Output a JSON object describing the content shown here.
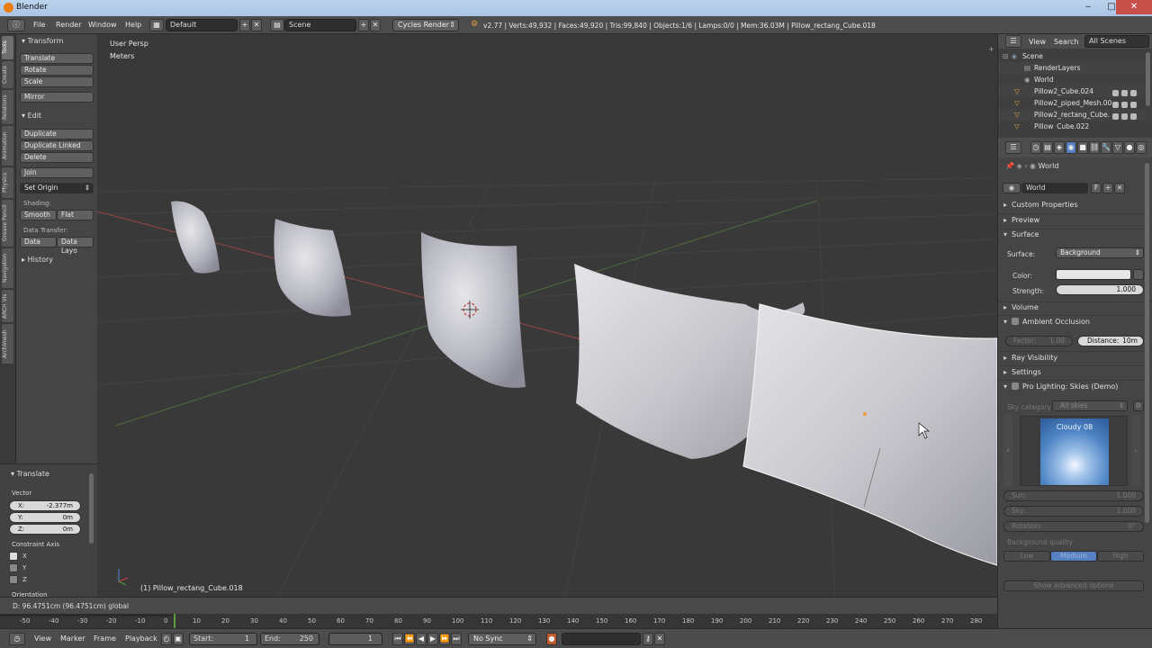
{
  "window": {
    "title": "Blender"
  },
  "menu": {
    "items": [
      "File",
      "Render",
      "Window",
      "Help"
    ]
  },
  "header": {
    "layout": "Default",
    "scene": "Scene",
    "engine": "Cycles Render",
    "stats": "v2.77 | Verts:49,932 | Faces:49,920 | Tris:99,840 | Objects:1/6 | Lamps:0/0 | Mem:36.03M | Pillow_rectang_Cube.018"
  },
  "tool_tabs": [
    "Tools",
    "Create",
    "Relations",
    "Animation",
    "Physics",
    "Grease Pencil",
    "Navigation",
    "ARCH Vis",
    "Archimesh"
  ],
  "toolshelf": {
    "transform": {
      "title": "Transform",
      "buttons": [
        "Translate",
        "Rotate",
        "Scale",
        "Mirror"
      ]
    },
    "edit": {
      "title": "Edit",
      "buttons": [
        "Duplicate",
        "Duplicate Linked",
        "Delete",
        "Join"
      ],
      "set_origin": "Set Origin"
    },
    "shading": {
      "label": "Shading:",
      "smooth": "Smooth",
      "flat": "Flat"
    },
    "data_transfer": {
      "label": "Data Transfer:",
      "data": "Data",
      "data_layout": "Data Layo"
    },
    "history": "History"
  },
  "operator": {
    "title": "Translate",
    "vector_label": "Vector",
    "x": {
      "label": "X:",
      "value": "-2.377m"
    },
    "y": {
      "label": "Y:",
      "value": "0m"
    },
    "z": {
      "label": "Z:",
      "value": "0m"
    },
    "constraint_label": "Constraint Axis",
    "axes": [
      "X",
      "Y",
      "Z"
    ],
    "orientation_label": "Orientation"
  },
  "viewport": {
    "view_name": "User Persp",
    "units": "Meters",
    "object_label": "(1) Pillow_rectang_Cube.018",
    "status": "D: 96.4751cm (96.4751cm) global"
  },
  "timeline": {
    "ticks": [
      "-50",
      "-40",
      "-30",
      "-20",
      "-10",
      "0",
      "10",
      "20",
      "30",
      "40",
      "50",
      "60",
      "70",
      "80",
      "90",
      "100",
      "110",
      "120",
      "130",
      "140",
      "150",
      "160",
      "170",
      "180",
      "190",
      "200",
      "210",
      "220",
      "230",
      "240",
      "250",
      "260",
      "270",
      "280"
    ],
    "menus": [
      "View",
      "Marker",
      "Frame",
      "Playback"
    ],
    "start_label": "Start:",
    "start": "1",
    "end_label": "End:",
    "end": "250",
    "current": "1",
    "sync": "No Sync"
  },
  "outliner": {
    "menus": [
      "View",
      "Search"
    ],
    "filter": "All Scenes",
    "rows": [
      "Scene",
      "RenderLayers",
      "World",
      "Pillow2_Cube.024",
      "Pillow2_piped_Mesh.00",
      "Pillow2_rectang_Cube.",
      "Pillow_Cube.022"
    ]
  },
  "properties": {
    "context": "World",
    "world_name": "World",
    "world_flag": "F",
    "sections": {
      "custom_props": "Custom Properties",
      "preview": "Preview",
      "surface": "Surface",
      "volume": "Volume",
      "ao": "Ambient Occlusion",
      "ray_vis": "Ray Visibility",
      "settings": "Settings",
      "pro_lighting": "Pro Lighting: Skies (Demo)"
    },
    "surface_label": "Surface:",
    "surface_value": "Background",
    "color_label": "Color:",
    "strength_label": "Strength:",
    "strength_value": "1.000",
    "ao_factor_label": "Factor:",
    "ao_factor_value": "1.00",
    "ao_distance_label": "Distance:",
    "ao_distance_value": "10m",
    "sky_label": "Sky category",
    "sky_category": "All skies",
    "sky_name": "Cloudy 08",
    "sun_label": "Sun:",
    "sun_value": "1.000",
    "sky_strength_label": "Sky:",
    "sky_strength_value": "1.000",
    "rotation_label": "Rotation:",
    "rotation_value": "0°",
    "bg_quality_label": "Background quality",
    "quality_options": [
      "Low",
      "Medium",
      "High"
    ],
    "advanced": "Show advanced options"
  },
  "colors": {
    "accent": "#5680c2",
    "header": "#4d4d4d",
    "viewport": "#393939"
  }
}
